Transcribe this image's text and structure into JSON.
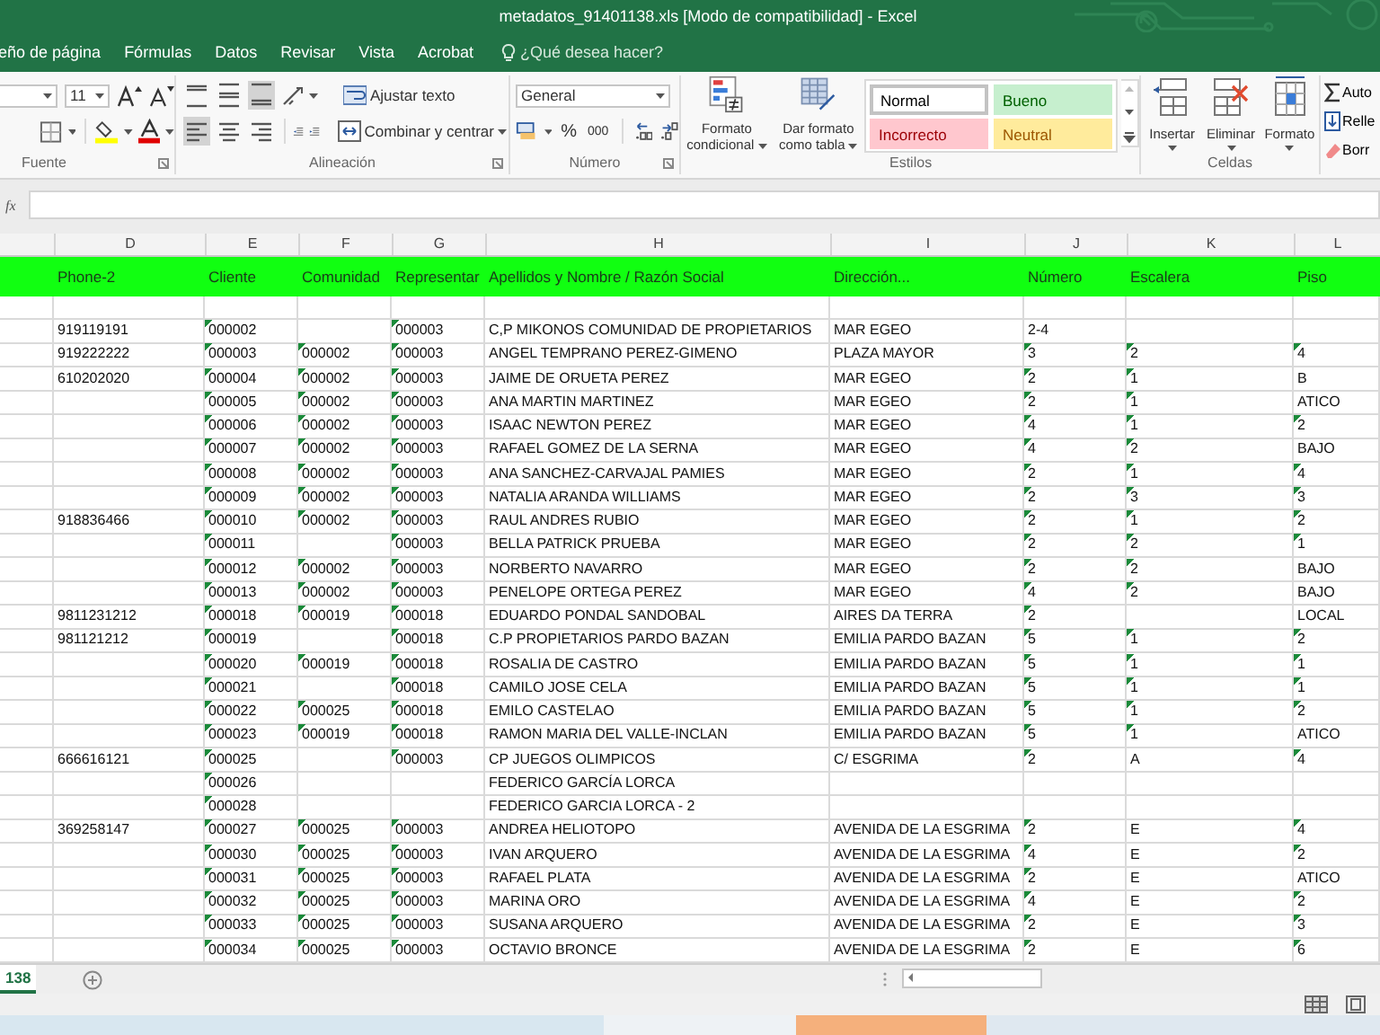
{
  "window": {
    "title": "metadatos_91401138.xls  [Modo de compatibilidad] - Excel"
  },
  "ribbon_tabs": [
    "eño de página",
    "Fórmulas",
    "Datos",
    "Revisar",
    "Vista",
    "Acrobat"
  ],
  "tell_me": {
    "placeholder": "¿Qué desea hacer?"
  },
  "ribbon": {
    "fuente": {
      "label": "Fuente",
      "font_size": "11"
    },
    "alineacion": {
      "label": "Alineación",
      "vertical_align": [
        {
          "selected": false
        },
        {
          "selected": false
        },
        {
          "selected": true
        }
      ],
      "horizontal_align": [
        {
          "selected": true
        },
        {
          "selected": false
        },
        {
          "selected": false
        }
      ],
      "wrap": "Ajustar texto",
      "merge": "Combinar y centrar"
    },
    "numero": {
      "label": "Número",
      "format": "General",
      "percent": "%",
      "thousands": "000"
    },
    "estilos": {
      "label": "Estilos",
      "conditional": "Formato condicional",
      "as_table": "Dar formato como tabla",
      "styles": [
        {
          "label": "Normal",
          "kind": "normal",
          "selected": true
        },
        {
          "label": "Bueno",
          "kind": "good",
          "selected": false
        },
        {
          "label": "Incorrecto",
          "kind": "bad",
          "selected": false
        },
        {
          "label": "Neutral",
          "kind": "neutral",
          "selected": false
        }
      ]
    },
    "celdas": {
      "label": "Celdas",
      "buttons": [
        "Insertar",
        "Eliminar",
        "Formato"
      ]
    },
    "edicion": {
      "items": [
        "Auto",
        "Relle",
        "Borr"
      ]
    }
  },
  "formula_bar": {
    "fx": "fx"
  },
  "columns": [
    "D",
    "E",
    "F",
    "G",
    "H",
    "I",
    "J",
    "K",
    "L"
  ],
  "header_row": [
    "Phone-2",
    "Cliente",
    "Comunidad",
    "Representar",
    "Apellidos y Nombre / Razón Social",
    "Dirección...",
    "Número",
    "Escalera",
    "Piso"
  ],
  "rows": [
    [
      "919119191",
      "000002",
      null,
      "000003",
      "C,P MIKONOS COMUNIDAD DE PROPIETARIOS",
      "MAR EGEO",
      "2-4",
      null,
      null
    ],
    [
      "919222222",
      "000003",
      "000002",
      "000003",
      "ANGEL TEMPRANO PEREZ-GIMENO",
      "PLAZA MAYOR",
      "3",
      "2",
      "4"
    ],
    [
      "610202020",
      "000004",
      "000002",
      "000003",
      "JAIME DE ORUETA PEREZ",
      "MAR EGEO",
      "2",
      "1",
      "B"
    ],
    [
      null,
      "000005",
      "000002",
      "000003",
      "ANA MARTIN MARTINEZ",
      "MAR EGEO",
      "2",
      "1",
      "ATICO"
    ],
    [
      null,
      "000006",
      "000002",
      "000003",
      "ISAAC NEWTON PEREZ",
      "MAR EGEO",
      "4",
      "1",
      "2"
    ],
    [
      null,
      "000007",
      "000002",
      "000003",
      "RAFAEL GOMEZ DE LA SERNA",
      "MAR EGEO",
      "4",
      "2",
      "BAJO"
    ],
    [
      null,
      "000008",
      "000002",
      "000003",
      "ANA SANCHEZ-CARVAJAL PAMIES",
      "MAR EGEO",
      "2",
      "1",
      "4"
    ],
    [
      null,
      "000009",
      "000002",
      "000003",
      "NATALIA ARANDA WILLIAMS",
      "MAR EGEO",
      "2",
      "3",
      "3"
    ],
    [
      "918836466",
      "000010",
      "000002",
      "000003",
      "RAUL ANDRES RUBIO",
      "MAR EGEO",
      "2",
      "1",
      "2"
    ],
    [
      null,
      "000011",
      null,
      "000003",
      "BELLA PATRICK  PRUEBA",
      "MAR EGEO",
      "2",
      "2",
      "1"
    ],
    [
      null,
      "000012",
      "000002",
      "000003",
      "NORBERTO NAVARRO",
      "MAR EGEO",
      "2",
      "2",
      "BAJO"
    ],
    [
      null,
      "000013",
      "000002",
      "000003",
      "PENELOPE ORTEGA PEREZ",
      "MAR EGEO",
      "4",
      "2",
      "BAJO"
    ],
    [
      "9811231212",
      "000018",
      "000019",
      "000018",
      "EDUARDO PONDAL SANDOBAL",
      "AIRES DA TERRA",
      "2",
      null,
      "LOCAL"
    ],
    [
      "981121212",
      "000019",
      null,
      "000018",
      "C.P PROPIETARIOS PARDO BAZAN",
      "EMILIA PARDO BAZAN",
      "5",
      "1",
      "2"
    ],
    [
      null,
      "000020",
      "000019",
      "000018",
      "ROSALIA DE CASTRO",
      "EMILIA PARDO BAZAN",
      "5",
      "1",
      "1"
    ],
    [
      null,
      "000021",
      null,
      "000018",
      "CAMILO JOSE CELA",
      "EMILIA PARDO BAZAN",
      "5",
      "1",
      "1"
    ],
    [
      null,
      "000022",
      "000025",
      "000018",
      "EMILO CASTELAO",
      "EMILIA PARDO BAZAN",
      "5",
      "1",
      "2"
    ],
    [
      null,
      "000023",
      "000019",
      "000018",
      "RAMON MARIA DEL VALLE-INCLAN",
      "EMILIA PARDO BAZAN",
      "5",
      "1",
      "ATICO"
    ],
    [
      "666616121",
      "000025",
      null,
      "000003",
      "CP JUEGOS OLIMPICOS",
      "C/ ESGRIMA",
      "2",
      "A",
      "4"
    ],
    [
      null,
      "000026",
      null,
      null,
      "FEDERICO GARCÍA LORCA",
      null,
      null,
      null,
      null
    ],
    [
      null,
      "000028",
      null,
      null,
      "FEDERICO GARCIA LORCA - 2",
      null,
      null,
      null,
      null
    ],
    [
      "369258147",
      "000027",
      "000025",
      "000003",
      "ANDREA HELIOTOPO",
      "AVENIDA DE LA ESGRIMA",
      "2",
      "E",
      "4"
    ],
    [
      null,
      "000030",
      "000025",
      "000003",
      "IVAN ARQUERO",
      "AVENIDA DE LA ESGRIMA",
      "4",
      "E",
      "2"
    ],
    [
      null,
      "000031",
      "000025",
      "000003",
      "RAFAEL PLATA",
      "AVENIDA DE LA ESGRIMA",
      "2",
      "E",
      "ATICO"
    ],
    [
      null,
      "000032",
      "000025",
      "000003",
      "MARINA ORO",
      "AVENIDA DE LA ESGRIMA",
      "4",
      "E",
      "2"
    ],
    [
      null,
      "000033",
      "000025",
      "000003",
      "SUSANA ARQUERO",
      "AVENIDA DE LA ESGRIMA",
      "2",
      "E",
      "3"
    ],
    [
      null,
      "000034",
      "000025",
      "000003",
      "OCTAVIO BRONCE",
      "AVENIDA DE LA ESGRIMA",
      "2",
      "E",
      "6"
    ]
  ],
  "sheet_tabs": [
    {
      "label": "138",
      "selected": true
    }
  ]
}
